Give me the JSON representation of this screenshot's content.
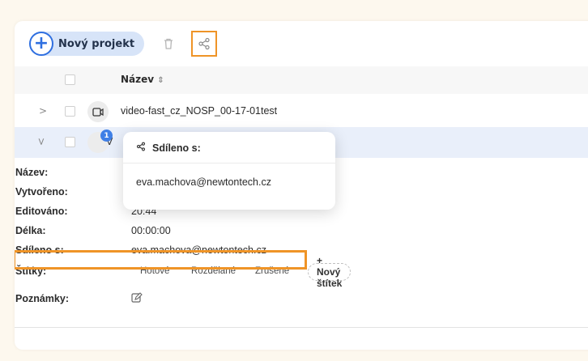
{
  "toolbar": {
    "new_project_label": "Nový projekt",
    "delete_icon": "trash-icon",
    "share_icon": "share-icon"
  },
  "table": {
    "column_name": "Název",
    "rows": [
      {
        "name": "video-fast_cz_NOSP_00-17-01test"
      },
      {
        "name_visible": "V"
      }
    ]
  },
  "details": {
    "name_label": "Název:",
    "created_label": "Vytvořeno:",
    "edited_label": "Editováno:",
    "edited_value": "20:44",
    "length_label": "Délka:",
    "length_value": "00:00:00",
    "shared_label": "Sdíleno s:",
    "shared_value": "eva.machova@newtontech.cz",
    "tags_label": "Štítky:",
    "tags": [
      "Hotové",
      "Rozdělané",
      "Zrušené"
    ],
    "new_tag_label": "+ Nový štítek",
    "notes_label": "Poznámky:"
  },
  "popup": {
    "title": "Sdíleno s:",
    "email": "eva.machova@newtontech.cz",
    "badge_count": "1"
  },
  "colors": {
    "accent": "#2f6fe0",
    "highlight": "#ef9427",
    "selected_row": "#e9effa"
  }
}
